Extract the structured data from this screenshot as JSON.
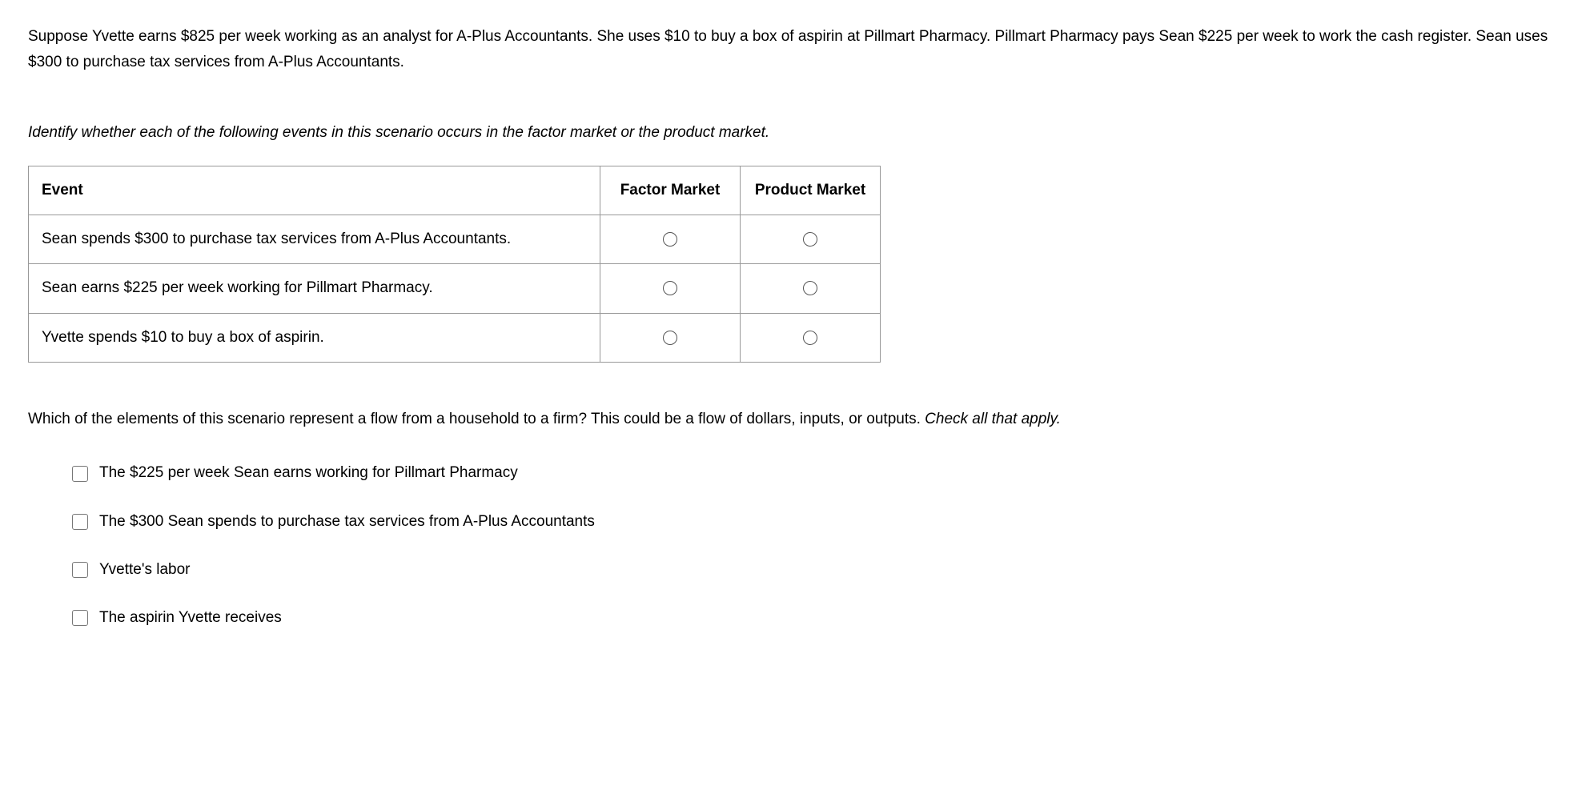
{
  "scenario": "Suppose Yvette earns $825 per week working as an analyst for A-Plus Accountants. She uses $10 to buy a box of aspirin at Pillmart Pharmacy. Pillmart Pharmacy pays Sean $225 per week to work the cash register. Sean uses $300 to purchase tax services from A-Plus Accountants.",
  "instruction": "Identify whether each of the following events in this scenario occurs in the factor market or the product market.",
  "table": {
    "headers": {
      "event": "Event",
      "factor": "Factor Market",
      "product": "Product Market"
    },
    "rows": [
      {
        "event": "Sean spends $300 to purchase tax services from A-Plus Accountants."
      },
      {
        "event": "Sean earns $225 per week working for Pillmart Pharmacy."
      },
      {
        "event": "Yvette spends $10 to buy a box of aspirin."
      }
    ]
  },
  "question2": {
    "text": "Which of the elements of this scenario represent a flow from a household to a firm? This could be a flow of dollars, inputs, or outputs. ",
    "hint": "Check all that apply."
  },
  "checkboxes": [
    "The $225 per week Sean earns working for Pillmart Pharmacy",
    "The $300 Sean spends to purchase tax services from A-Plus Accountants",
    "Yvette's labor",
    "The aspirin Yvette receives"
  ]
}
